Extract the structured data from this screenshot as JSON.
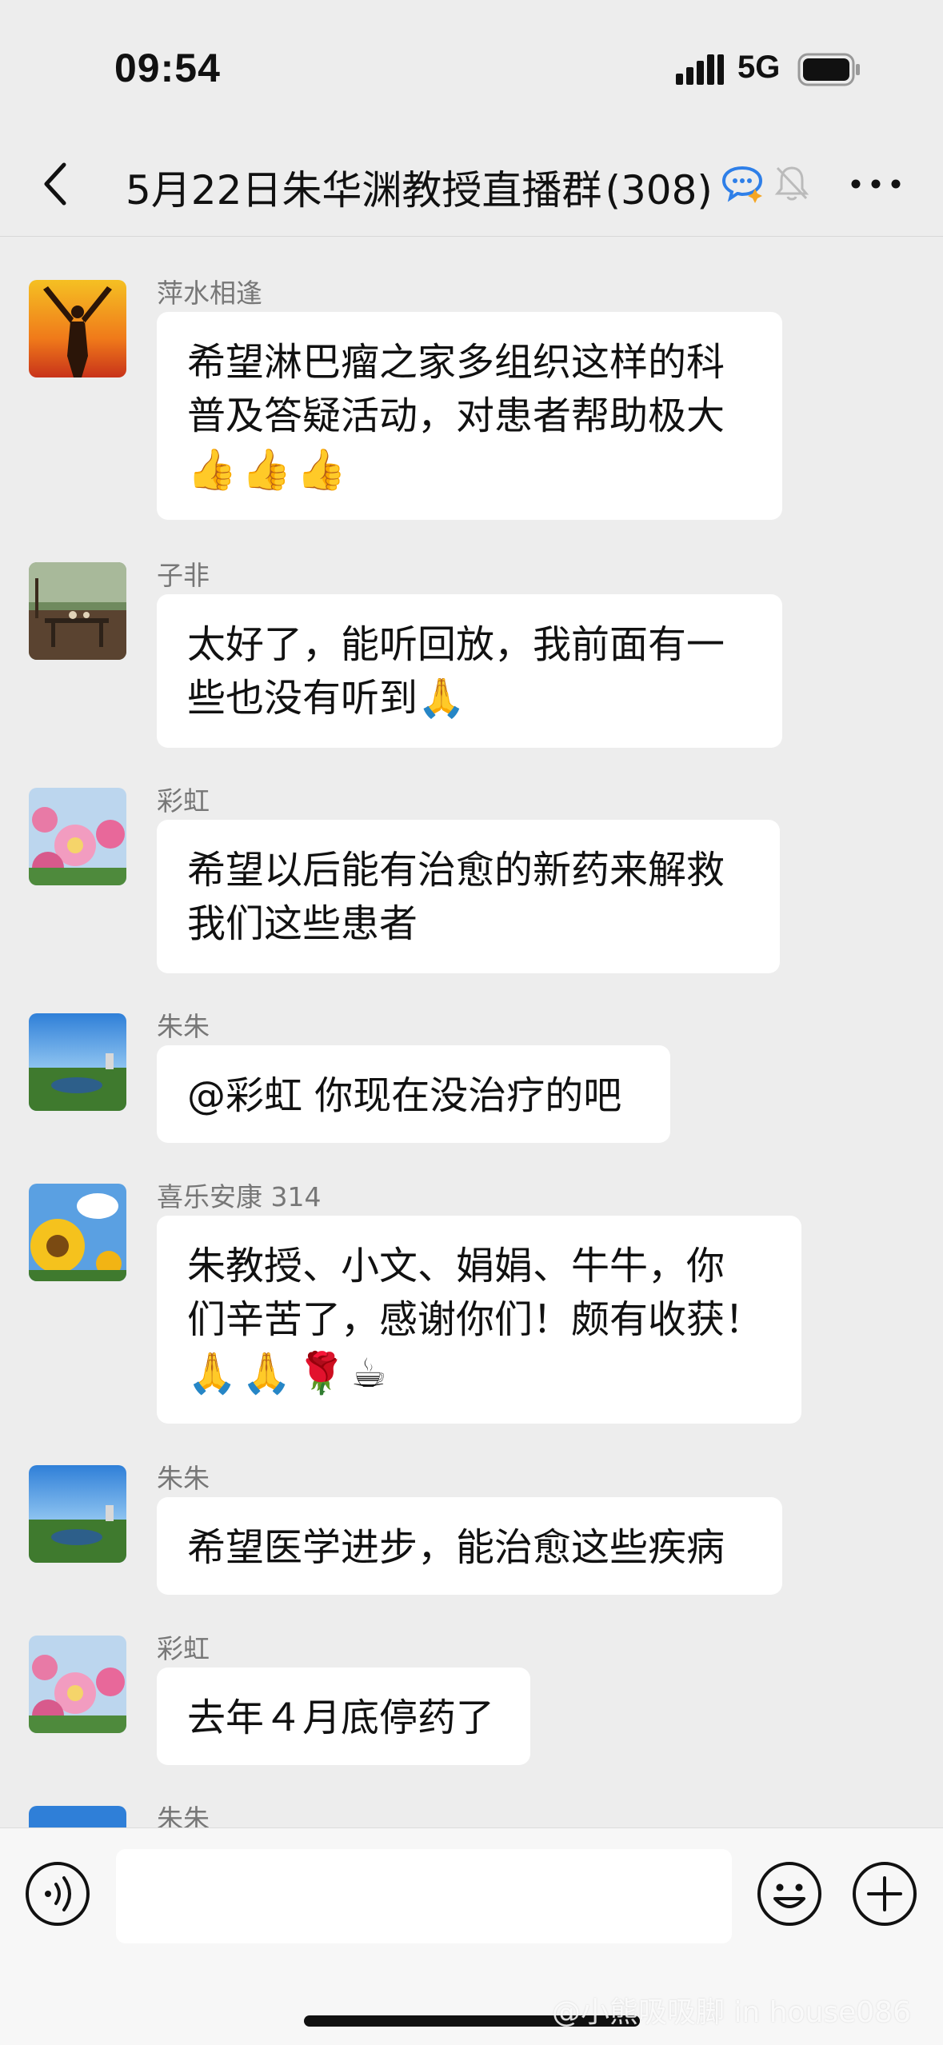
{
  "status_bar": {
    "time": "09:54",
    "network": "5G"
  },
  "header": {
    "title": "5月22日朱华渊教授直播群",
    "member_count": "(308)"
  },
  "messages": [
    {
      "sender": "萍水相逢",
      "lines": [
        "希望淋巴瘤之家多组织这样的科",
        "普及答疑活动，对患者帮助极大"
      ],
      "emoji": "👍👍👍"
    },
    {
      "sender": "子非",
      "lines": [
        "太好了，能听回放，我前面有一",
        "些也没有听到🙏"
      ]
    },
    {
      "sender": "彩虹",
      "lines": [
        "希望以后能有治愈的新药来解救",
        "我们这些患者"
      ]
    },
    {
      "sender": "朱朱",
      "lines": [
        "@彩虹 你现在没治疗的吧"
      ]
    },
    {
      "sender": "喜乐安康 314",
      "lines": [
        "朱教授、小文、娟娟、牛牛，你",
        "们辛苦了，感谢你们！颇有收获！"
      ],
      "emoji": "🙏🙏🌹☕"
    },
    {
      "sender": "朱朱",
      "lines": [
        "希望医学进步，能治愈这些疾病"
      ]
    },
    {
      "sender": "彩虹",
      "lines": [
        "去年４月底停药了"
      ]
    },
    {
      "sender": "朱朱"
    }
  ],
  "input_bar": {
    "placeholder": ""
  },
  "watermark": "@小熊吸吸脚 in house086"
}
